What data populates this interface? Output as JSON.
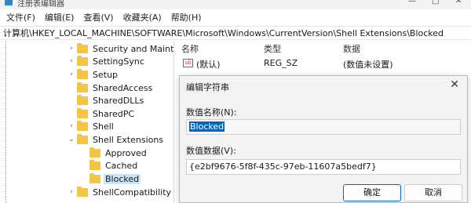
{
  "window": {
    "title": "注册表编辑器",
    "controls": {
      "minimize": "—",
      "maximize": "□",
      "close": "✕"
    }
  },
  "menu": {
    "items": [
      "文件(F)",
      "编辑(E)",
      "查看(V)",
      "收藏夹(A)",
      "帮助(H)"
    ]
  },
  "address": {
    "path": "计算机\\HKEY_LOCAL_MACHINE\\SOFTWARE\\Microsoft\\Windows\\CurrentVersion\\Shell Extensions\\Blocked"
  },
  "tree": {
    "items": [
      {
        "label": "Security and Mainte",
        "expanded": false
      },
      {
        "label": "SettingSync",
        "expanded": false
      },
      {
        "label": "Setup",
        "expanded": false
      },
      {
        "label": "SharedAccess",
        "expanded": null
      },
      {
        "label": "SharedDLLs",
        "expanded": null
      },
      {
        "label": "SharedPC",
        "expanded": null
      },
      {
        "label": "Shell",
        "expanded": false
      },
      {
        "label": "Shell Extensions",
        "expanded": true
      },
      {
        "label": "Approved",
        "expanded": null
      },
      {
        "label": "Cached",
        "expanded": null
      },
      {
        "label": "Blocked",
        "expanded": null,
        "selected": true
      },
      {
        "label": "ShellCompatibility",
        "expanded": false
      }
    ]
  },
  "list": {
    "headers": {
      "name": "名称",
      "type": "类型",
      "data": "数据"
    },
    "rows": [
      {
        "icon": "ab",
        "name": "(默认)",
        "type": "REG_SZ",
        "data": "(数值未设置)"
      }
    ]
  },
  "dialog": {
    "title": "编辑字符串",
    "close": "✕",
    "name_label": "数值名称(N):",
    "name_value": "Blocked",
    "data_label": "数值数据(V):",
    "data_value": "{e2bf9676-5f8f-435c-97eb-11607a5bedf7}",
    "ok": "确定",
    "cancel": "取消"
  },
  "colors": {
    "folder": "#f4c542",
    "selection": "#0067c0",
    "tree_selected": "#cce4f7"
  }
}
